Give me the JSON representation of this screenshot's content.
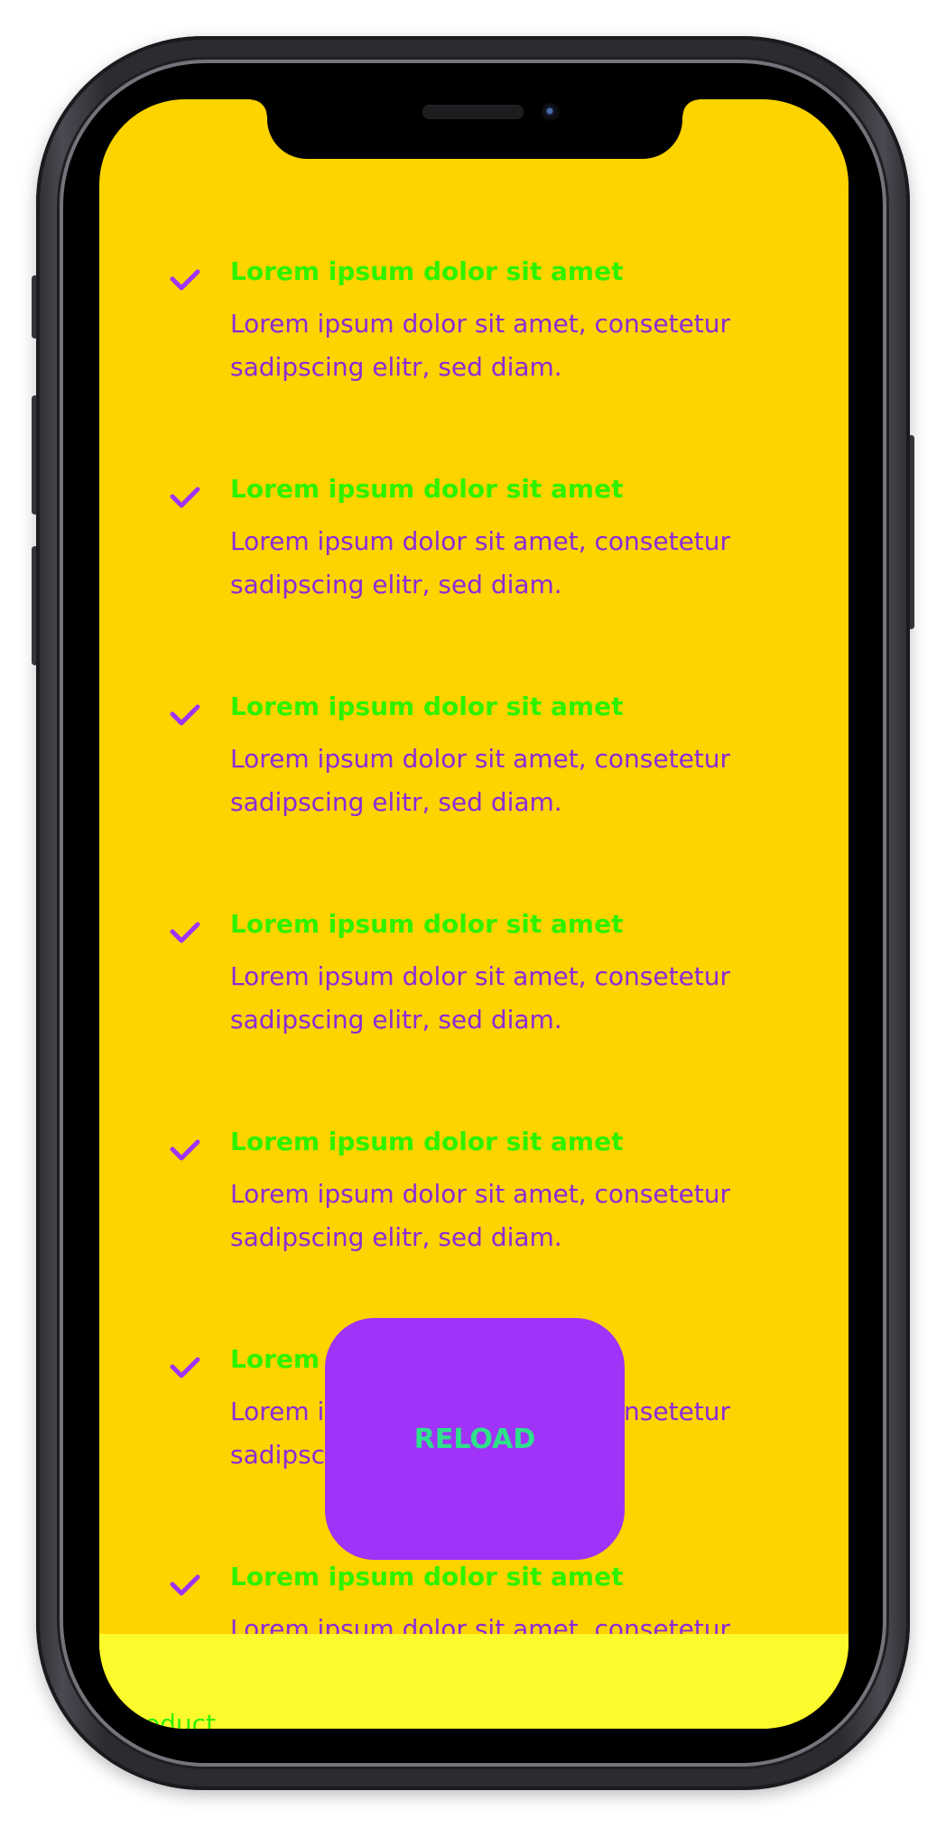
{
  "items": [
    {
      "title": "Lorem ipsum dolor sit amet",
      "description": "Lorem ipsum dolor sit amet, consetetur sadipscing elitr, sed diam."
    },
    {
      "title": "Lorem ipsum dolor sit amet",
      "description": "Lorem ipsum dolor sit amet, consetetur sadipscing elitr, sed diam."
    },
    {
      "title": "Lorem ipsum dolor sit amet",
      "description": "Lorem ipsum dolor sit amet, consetetur sadipscing elitr, sed diam."
    },
    {
      "title": "Lorem ipsum dolor sit amet",
      "description": "Lorem ipsum dolor sit amet, consetetur sadipscing elitr, sed diam."
    },
    {
      "title": "Lorem ipsum dolor sit amet",
      "description": "Lorem ipsum dolor sit amet, consetetur sadipscing elitr, sed diam."
    },
    {
      "title": "Lorem ipsum dolor sit amet",
      "description": "Lorem ipsum dolor sit amet, consetetur sadipscing elitr, sed diam."
    },
    {
      "title": "Lorem ipsum dolor sit amet",
      "description": "Lorem ipsum dolor sit amet, consetetur sadipscing elitr, sed diam."
    }
  ],
  "item_icon": "check-icon",
  "reload_button": {
    "label": "RELOAD"
  },
  "footer": {
    "partial_text": "oduct"
  },
  "colors": {
    "screen_background": "#fdd300",
    "title_text": "#2ef200",
    "description_text": "#8b2bd9",
    "check_icon": "#a033f7",
    "button_background": "#a033f7",
    "button_text": "#2ee28a",
    "footer_background": "#fcf92c"
  }
}
